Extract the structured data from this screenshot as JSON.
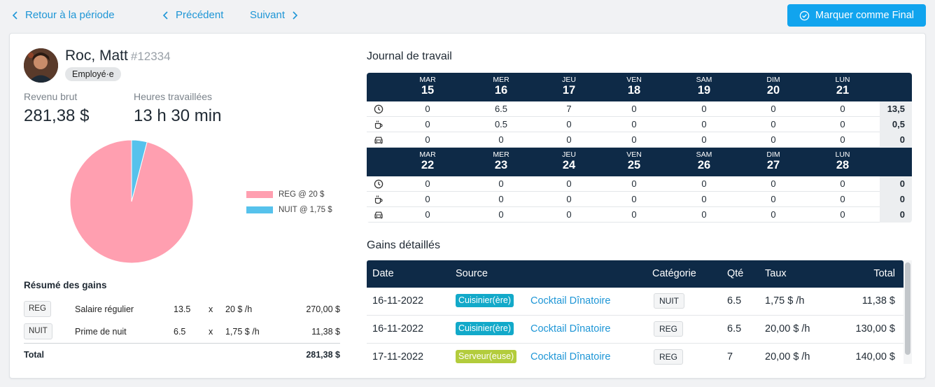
{
  "nav": {
    "back_label": "Retour à la période",
    "prev_label": "Précédent",
    "next_label": "Suivant",
    "final_label": "Marquer comme Final"
  },
  "employee": {
    "name": "Roc, Matt",
    "id": "#12334",
    "role": "Employé·e",
    "gross_label": "Revenu brut",
    "gross_value": "281,38 $",
    "hours_label": "Heures travaillées",
    "hours_value": "13 h 30 min"
  },
  "chart_data": {
    "type": "pie",
    "categories": [
      "REG @ 20 $",
      "NUIT @ 1,75 $"
    ],
    "values": [
      270.0,
      11.38
    ],
    "colors": [
      "#ff9fb0",
      "#56c2ec"
    ],
    "legend_position": "right"
  },
  "summary": {
    "title": "Résumé des gains",
    "rows": [
      {
        "tag": "REG",
        "label": "Salaire régulier",
        "qty": "13.5",
        "x": "x",
        "rate": "20 $ /h",
        "amount": "270,00 $"
      },
      {
        "tag": "NUIT",
        "label": "Prime de nuit",
        "qty": "6.5",
        "x": "x",
        "rate": "1,75 $ /h",
        "amount": "11,38 $"
      }
    ],
    "total_label": "Total",
    "total_value": "281,38 $"
  },
  "journal": {
    "title": "Journal de travail",
    "weeks": [
      {
        "days": [
          {
            "name": "MAR",
            "num": "15"
          },
          {
            "name": "MER",
            "num": "16"
          },
          {
            "name": "JEU",
            "num": "17"
          },
          {
            "name": "VEN",
            "num": "18"
          },
          {
            "name": "SAM",
            "num": "19"
          },
          {
            "name": "DIM",
            "num": "20"
          },
          {
            "name": "LUN",
            "num": "21"
          }
        ],
        "rows": [
          {
            "icon": "clock-icon",
            "values": [
              "0",
              "6.5",
              "7",
              "0",
              "0",
              "0",
              "0"
            ],
            "total": "13,5"
          },
          {
            "icon": "coffee-icon",
            "values": [
              "0",
              "0.5",
              "0",
              "0",
              "0",
              "0",
              "0"
            ],
            "total": "0,5"
          },
          {
            "icon": "car-icon",
            "values": [
              "0",
              "0",
              "0",
              "0",
              "0",
              "0",
              "0"
            ],
            "total": "0"
          }
        ]
      },
      {
        "days": [
          {
            "name": "MAR",
            "num": "22"
          },
          {
            "name": "MER",
            "num": "23"
          },
          {
            "name": "JEU",
            "num": "24"
          },
          {
            "name": "VEN",
            "num": "25"
          },
          {
            "name": "SAM",
            "num": "26"
          },
          {
            "name": "DIM",
            "num": "27"
          },
          {
            "name": "LUN",
            "num": "28"
          }
        ],
        "rows": [
          {
            "icon": "clock-icon",
            "values": [
              "0",
              "0",
              "0",
              "0",
              "0",
              "0",
              "0"
            ],
            "total": "0"
          },
          {
            "icon": "coffee-icon",
            "values": [
              "0",
              "0",
              "0",
              "0",
              "0",
              "0",
              "0"
            ],
            "total": "0"
          },
          {
            "icon": "car-icon",
            "values": [
              "0",
              "0",
              "0",
              "0",
              "0",
              "0",
              "0"
            ],
            "total": "0"
          }
        ]
      }
    ]
  },
  "gains": {
    "title": "Gains détaillés",
    "columns": {
      "date": "Date",
      "source": "Source",
      "category": "Catégorie",
      "qty": "Qté",
      "rate": "Taux",
      "total": "Total"
    },
    "rows": [
      {
        "date": "16-11-2022",
        "role": "Cuisinier(ère)",
        "role_color": "#12a9c9",
        "event": "Cocktail Dînatoire",
        "category": "NUIT",
        "qty": "6.5",
        "rate": "1,75 $ /h",
        "total": "11,38 $"
      },
      {
        "date": "16-11-2022",
        "role": "Cuisinier(ère)",
        "role_color": "#12a9c9",
        "event": "Cocktail Dînatoire",
        "category": "REG",
        "qty": "6.5",
        "rate": "20,00 $ /h",
        "total": "130,00 $"
      },
      {
        "date": "17-11-2022",
        "role": "Serveur(euse)",
        "role_color": "#b3cc3c",
        "event": "Cocktail Dînatoire",
        "category": "REG",
        "qty": "7",
        "rate": "20,00 $ /h",
        "total": "140,00 $"
      }
    ]
  }
}
